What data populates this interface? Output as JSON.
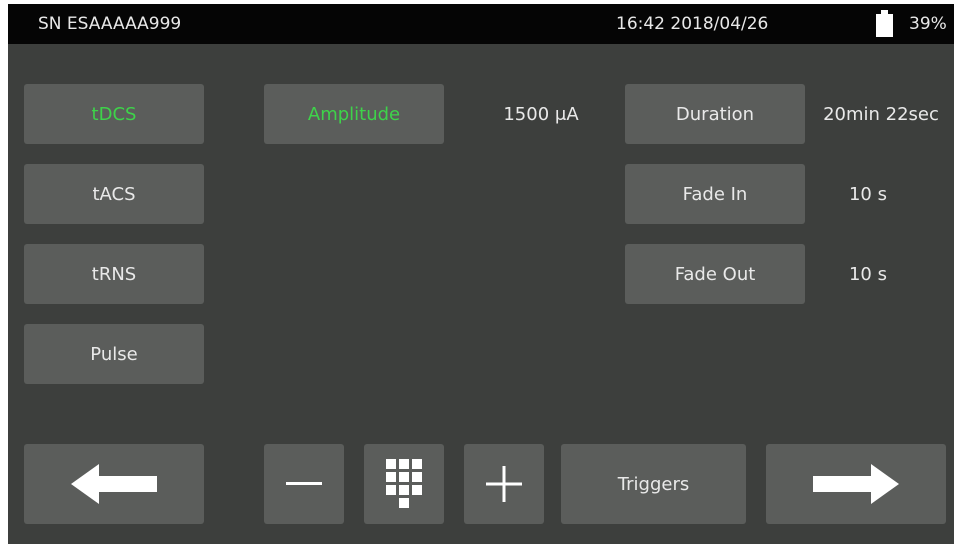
{
  "status": {
    "serial": "SN ESAAAAA999",
    "datetime": "16:42 2018/04/26",
    "battery_percent": "39%",
    "battery_level": 0.39
  },
  "modes": [
    {
      "label": "tDCS",
      "active": true
    },
    {
      "label": "tACS",
      "active": false
    },
    {
      "label": "tRNS",
      "active": false
    },
    {
      "label": "Pulse",
      "active": false
    }
  ],
  "params": {
    "amplitude_label": "Amplitude",
    "amplitude_value": "1500 μA",
    "duration_label": "Duration",
    "duration_value": "20min 22sec",
    "fade_in_label": "Fade In",
    "fade_in_value": "10 s",
    "fade_out_label": "Fade Out",
    "fade_out_value": "10 s"
  },
  "toolbar": {
    "back_icon": "arrow-left-icon",
    "minus_icon": "minus-icon",
    "keypad_icon": "keypad-icon",
    "plus_icon": "plus-icon",
    "triggers_label": "Triggers",
    "next_icon": "arrow-right-icon"
  },
  "colors": {
    "background": "#3d3f3d",
    "statusbar": "#050505",
    "button": "#5b5d5b",
    "active_text": "#3ed34a",
    "text": "#e9e9e9"
  }
}
